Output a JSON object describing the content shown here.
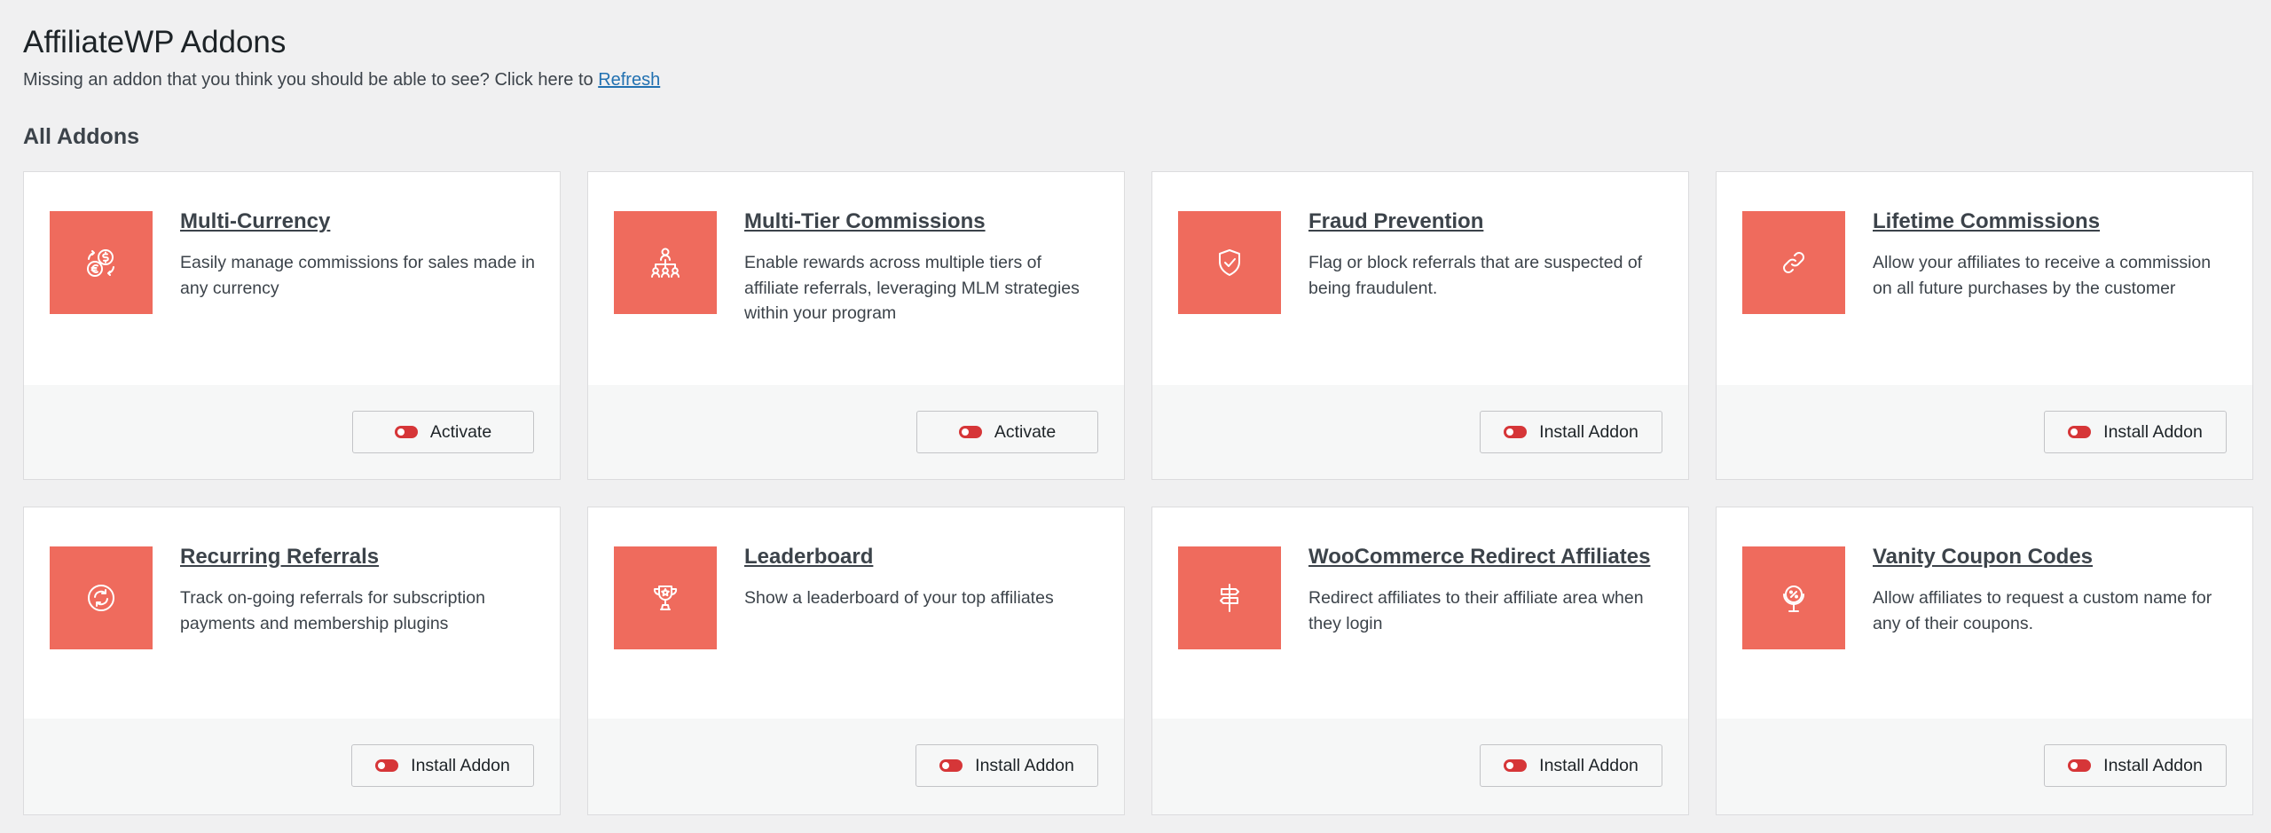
{
  "page": {
    "title": "AffiliateWP Addons",
    "subtitle_text": "Missing an addon that you think you should be able to see? Click here to ",
    "refresh_link": "Refresh",
    "section_heading": "All Addons"
  },
  "colors": {
    "icon_bg": "#ef6b5d",
    "toggle_off": "#d63638",
    "link": "#2271b1"
  },
  "addons": [
    {
      "title": "Multi-Currency",
      "desc": "Easily manage commissions for sales made in any currency",
      "button": "Activate",
      "icon": "currency-exchange-icon"
    },
    {
      "title": "Multi-Tier Commissions",
      "desc": "Enable rewards across multiple tiers of affiliate referrals, leveraging MLM strategies within your program",
      "button": "Activate",
      "icon": "hierarchy-icon"
    },
    {
      "title": "Fraud Prevention",
      "desc": "Flag or block referrals that are suspected of being fraudulent.",
      "button": "Install Addon",
      "icon": "shield-check-icon"
    },
    {
      "title": "Lifetime Commissions",
      "desc": "Allow your affiliates to receive a commission on all future purchases by the customer",
      "button": "Install Addon",
      "icon": "link-icon"
    },
    {
      "title": "Recurring Referrals",
      "desc": "Track on-going referrals for subscription payments and membership plugins",
      "button": "Install Addon",
      "icon": "refresh-cycle-icon"
    },
    {
      "title": "Leaderboard",
      "desc": "Show a leaderboard of your top affiliates",
      "button": "Install Addon",
      "icon": "trophy-icon"
    },
    {
      "title": "WooCommerce Redirect Affiliates",
      "desc": "Redirect affiliates to their affiliate area when they login",
      "button": "Install Addon",
      "icon": "signpost-icon"
    },
    {
      "title": "Vanity Coupon Codes",
      "desc": "Allow affiliates to request a custom name for any of their coupons.",
      "button": "Install Addon",
      "icon": "coupon-badge-icon"
    }
  ]
}
